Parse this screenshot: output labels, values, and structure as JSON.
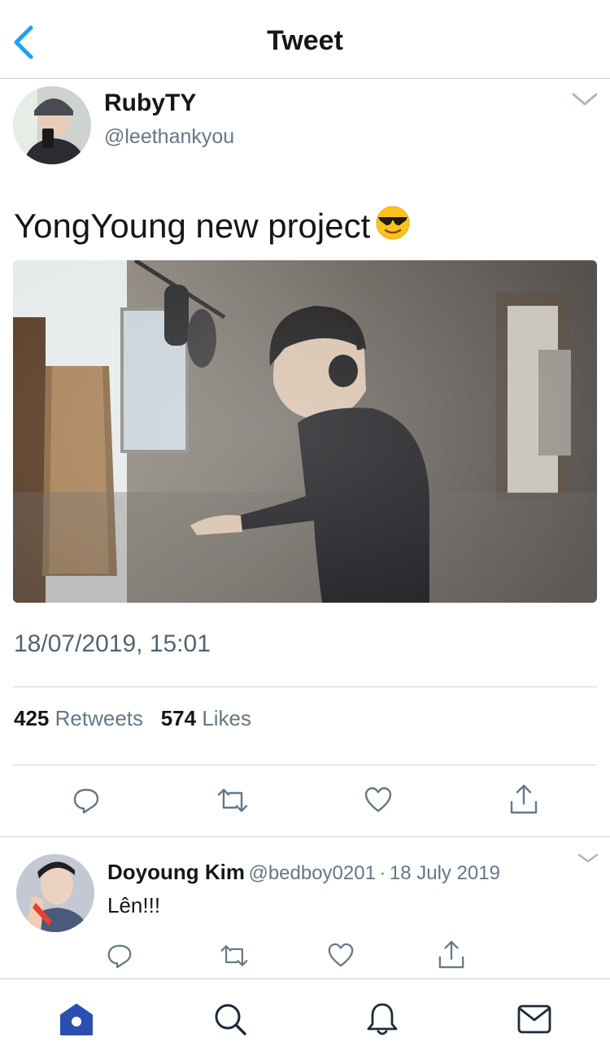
{
  "header": {
    "title": "Tweet"
  },
  "tweet": {
    "name": "RubyTY",
    "handle": "@leethankyou",
    "text": "YongYoung new project",
    "emoji": "smiling-face-with-sunglasses",
    "timestamp": "18/07/2019, 15:01",
    "retweet_count": "425",
    "retweet_label": "Retweets",
    "like_count": "574",
    "like_label": "Likes"
  },
  "reply": {
    "name": "Doyoung Kim",
    "handle": "@bedboy0201",
    "separator": "·",
    "date": "18 July 2019",
    "text": "Lên!!!"
  },
  "tabs": [
    {
      "icon": "home-icon",
      "active": true
    },
    {
      "icon": "search-icon",
      "active": false
    },
    {
      "icon": "bell-icon",
      "active": false
    },
    {
      "icon": "mail-icon",
      "active": false
    }
  ],
  "colors": {
    "accent": "#1da1f2",
    "active_tab": "#2a4fb0",
    "icon": "#657786",
    "text": "#14171a"
  }
}
